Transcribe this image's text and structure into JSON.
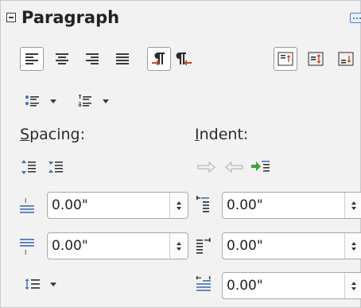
{
  "panel": {
    "title": "Paragraph",
    "colors": {
      "accent_blue": "#3d6fb8",
      "accent_red": "#d6401f",
      "accent_green": "#3fa63a",
      "dim_gray": "#b8b8b8"
    }
  },
  "toolbar_row1": {
    "buttons": [
      {
        "name": "align-left-button",
        "icon": "align-left-icon",
        "active": true
      },
      {
        "name": "align-center-button",
        "icon": "align-center-icon",
        "active": false
      },
      {
        "name": "align-right-button",
        "icon": "align-right-icon",
        "active": false
      },
      {
        "name": "justify-button",
        "icon": "justify-icon",
        "active": false
      },
      {
        "name": "ltr-button",
        "icon": "left-to-right-icon",
        "active": true
      },
      {
        "name": "rtl-button",
        "icon": "right-to-left-icon",
        "active": false
      },
      {
        "name": "align-top-button",
        "icon": "align-top-icon",
        "active": true
      },
      {
        "name": "align-middle-button",
        "icon": "align-middle-icon",
        "active": false
      },
      {
        "name": "align-bottom-button",
        "icon": "align-bottom-icon",
        "active": false
      }
    ]
  },
  "toolbar_row2": {
    "buttons": [
      {
        "name": "bullets-dropdown",
        "icon": "bullet-list-icon"
      },
      {
        "name": "numbering-dropdown",
        "icon": "numbered-list-icon"
      }
    ]
  },
  "spacing": {
    "label_prefix": "S",
    "label_rest": "pacing:",
    "above_value": "0.00\"",
    "below_value": "0.00\""
  },
  "indent": {
    "label_prefix": "I",
    "label_rest": "ndent:",
    "before_value": "0.00\"",
    "after_value": "0.00\"",
    "first_line_value": "0.00\""
  }
}
